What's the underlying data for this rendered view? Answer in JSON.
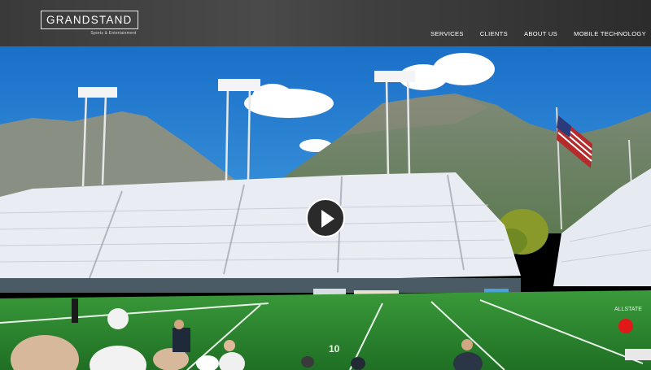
{
  "brand": {
    "name": "GRANDSTAND",
    "tagline": "Sports & Entertainment"
  },
  "nav": {
    "items": [
      "SERVICES",
      "CLIENTS",
      "ABOUT US",
      "MOBILE TECHNOLOGY"
    ]
  },
  "hero": {
    "field_marker": "10",
    "banner_text": "ALLSTATE",
    "play_icon": "play-icon"
  },
  "colors": {
    "header": "#3a3a3a",
    "sky": "#1e7fd0",
    "grass": "#2e8a2e",
    "crowd": "#e9ecf2",
    "record": "#e01818"
  }
}
